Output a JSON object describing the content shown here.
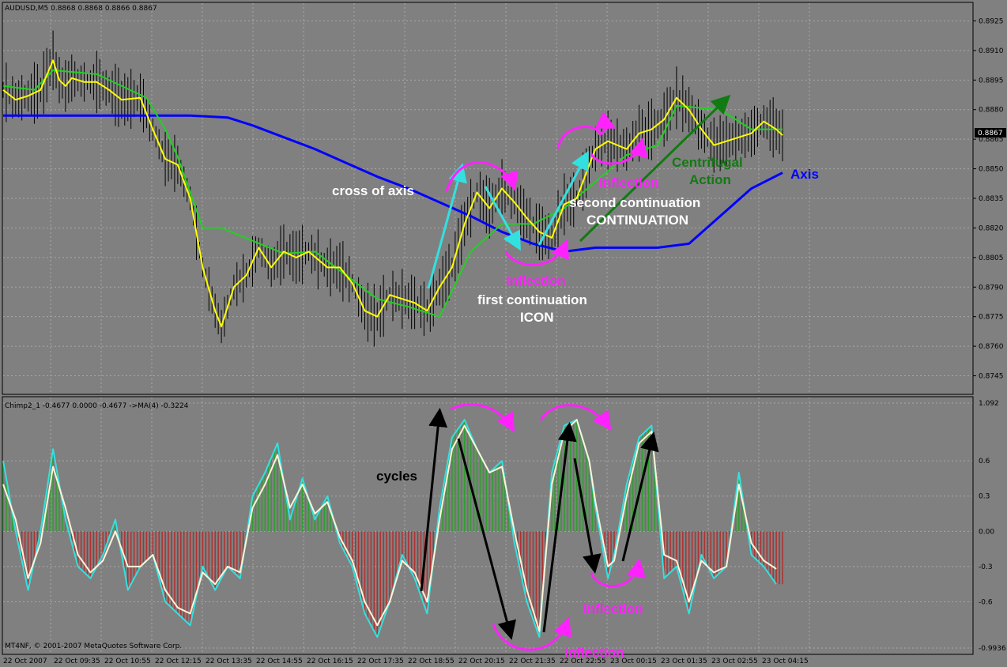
{
  "colors": {
    "background": "#808080",
    "axis_line": "#0000ff",
    "fast_ma": "#ffff00",
    "slow_ma": "#22d022",
    "bars": "#000000",
    "grid": "#a8a8a8",
    "osc_positive": "#2e9e2e",
    "osc_negative": "#b03030",
    "osc_main": "#33e0e0",
    "osc_signal": "#fff4d8",
    "inflection": "#ff22ff",
    "cyan_arrow": "#33e0e0",
    "green_arrow": "#127a12",
    "black_arrow": "#000000"
  },
  "main_panel": {
    "title": "AUDUSD,M5  0.8868 0.8868 0.8866 0.8867",
    "price_tag": "0.8867",
    "annotations": [
      {
        "text": "cross of axis",
        "color": "white"
      },
      {
        "text": "second continuation",
        "color": "white"
      },
      {
        "text": "CONTINUATION",
        "color": "white"
      },
      {
        "text": "inflection",
        "color": "magenta"
      },
      {
        "text": "inflection",
        "color": "magenta"
      },
      {
        "text": "first continuation",
        "color": "white"
      },
      {
        "text": "ICON",
        "color": "white"
      },
      {
        "text": "Centrifugal",
        "color": "green"
      },
      {
        "text": "Action",
        "color": "green"
      },
      {
        "text": "Axis",
        "color": "blue"
      }
    ]
  },
  "sub_panel": {
    "title": "Chimp2_1 -0.4677 0.0000 -0.4677  ->MA(4) -0.3224",
    "copyright": "MT4NF, © 2001-2007 MetaQuotes Software Corp.",
    "annotations": [
      {
        "text": "cycles",
        "color": "black"
      },
      {
        "text": "inflection",
        "color": "magenta"
      },
      {
        "text": "inflection",
        "color": "magenta"
      }
    ]
  },
  "chart_data": [
    {
      "type": "line",
      "title": "AUDUSD,M5  0.8868 0.8868 0.8866 0.8867",
      "y_ticks": [
        "0.8925",
        "0.8910",
        "0.8895",
        "0.8880",
        "0.8865",
        "0.8850",
        "0.8835",
        "0.8820",
        "0.8805",
        "0.8790",
        "0.8775",
        "0.8760",
        "0.8745"
      ],
      "ylim": [
        0.874,
        0.893
      ],
      "x_ticks": [
        "22 Oct 2007",
        "22 Oct 09:35",
        "22 Oct 10:55",
        "22 Oct 12:15",
        "22 Oct 13:35",
        "22 Oct 14:55",
        "22 Oct 16:15",
        "22 Oct 17:35",
        "22 Oct 18:55",
        "22 Oct 20:15",
        "22 Oct 21:35",
        "22 Oct 22:55",
        "23 Oct 00:15",
        "23 Oct 01:35",
        "23 Oct 02:55",
        "23 Oct 04:15"
      ],
      "grid": true,
      "series": [
        {
          "color": "#0000ff",
          "x": [
            0,
            30,
            60,
            72,
            80,
            90,
            100,
            110,
            120,
            130,
            140,
            150,
            160,
            170,
            180,
            190,
            200,
            210,
            220,
            230,
            240,
            250
          ],
          "values": [
            0.8877,
            0.8877,
            0.8877,
            0.8876,
            0.8872,
            0.8866,
            0.886,
            0.8853,
            0.8846,
            0.884,
            0.8833,
            0.8826,
            0.8818,
            0.8812,
            0.8808,
            0.881,
            0.881,
            0.881,
            0.8812,
            0.8826,
            0.884,
            0.8848
          ]
        },
        {
          "color": "#22d022",
          "x": [
            0,
            10,
            16,
            30,
            46,
            52,
            56,
            64,
            70,
            90,
            100,
            120,
            130,
            140,
            150,
            160,
            166,
            170,
            180,
            200,
            210,
            216,
            230,
            240,
            250
          ],
          "values": [
            0.8892,
            0.889,
            0.89,
            0.8898,
            0.8886,
            0.887,
            0.8856,
            0.882,
            0.882,
            0.8807,
            0.8808,
            0.8784,
            0.878,
            0.8775,
            0.8808,
            0.8822,
            0.8822,
            0.8822,
            0.883,
            0.8857,
            0.8862,
            0.8882,
            0.888,
            0.887,
            0.887
          ]
        },
        {
          "color": "#ffff00",
          "x": [
            0,
            4,
            8,
            12,
            16,
            18,
            20,
            22,
            26,
            30,
            34,
            38,
            44,
            48,
            52,
            56,
            60,
            64,
            68,
            70,
            74,
            78,
            82,
            86,
            90,
            94,
            98,
            104,
            108,
            112,
            116,
            120,
            124,
            128,
            132,
            136,
            140,
            144,
            148,
            152,
            156,
            160,
            164,
            168,
            172,
            176,
            180,
            184,
            188,
            190,
            194,
            200,
            204,
            208,
            212,
            216,
            220,
            224,
            228,
            232,
            236,
            240,
            244,
            248,
            250
          ],
          "values": [
            0.889,
            0.8885,
            0.8887,
            0.889,
            0.8905,
            0.8895,
            0.8892,
            0.8896,
            0.8894,
            0.8894,
            0.889,
            0.8885,
            0.8886,
            0.887,
            0.8855,
            0.8852,
            0.8835,
            0.88,
            0.8778,
            0.877,
            0.879,
            0.8796,
            0.881,
            0.88,
            0.8808,
            0.8805,
            0.8808,
            0.88,
            0.88,
            0.8792,
            0.8778,
            0.8775,
            0.8786,
            0.8784,
            0.8782,
            0.8778,
            0.879,
            0.88,
            0.8822,
            0.8838,
            0.883,
            0.884,
            0.8833,
            0.8825,
            0.8818,
            0.8815,
            0.8832,
            0.8835,
            0.8852,
            0.886,
            0.8864,
            0.886,
            0.8868,
            0.887,
            0.8875,
            0.8886,
            0.888,
            0.887,
            0.8862,
            0.8864,
            0.8866,
            0.8868,
            0.8874,
            0.887,
            0.8867
          ]
        }
      ]
    },
    {
      "type": "bar",
      "title": "Chimp2_1 -0.4677 0.0000 -0.4677  ->MA(4) -0.3224",
      "y_ticks": [
        "1.092",
        "0.6",
        "0.3",
        "0.00",
        "-0.3",
        "-0.6",
        "-0.9936"
      ],
      "ylim": [
        -0.9936,
        1.092
      ],
      "grid": true,
      "series": [
        {
          "color": "#33e0e0",
          "x": [
            0,
            4,
            8,
            12,
            16,
            20,
            24,
            28,
            32,
            36,
            40,
            44,
            48,
            52,
            56,
            60,
            64,
            68,
            72,
            76,
            80,
            84,
            88,
            92,
            96,
            100,
            104,
            108,
            112,
            116,
            120,
            124,
            128,
            132,
            136,
            140,
            144,
            148,
            152,
            156,
            160,
            164,
            168,
            172,
            176,
            180,
            184,
            188,
            190,
            194,
            196,
            200,
            204,
            208,
            212,
            216,
            220,
            224,
            228,
            232,
            236,
            240,
            244,
            248
          ],
          "values": [
            0.6,
            0.0,
            -0.5,
            0.0,
            0.7,
            0.1,
            -0.3,
            -0.4,
            -0.2,
            0.1,
            -0.5,
            -0.3,
            -0.2,
            -0.6,
            -0.7,
            -0.8,
            -0.3,
            -0.5,
            -0.3,
            -0.4,
            0.3,
            0.5,
            0.75,
            0.1,
            0.45,
            0.1,
            0.3,
            -0.1,
            -0.3,
            -0.7,
            -0.9,
            -0.6,
            -0.2,
            -0.4,
            -0.7,
            0.2,
            0.8,
            0.95,
            0.7,
            0.5,
            0.6,
            -0.1,
            -0.6,
            -0.9,
            0.5,
            0.9,
            0.95,
            0.6,
            0.2,
            -0.4,
            -0.2,
            0.4,
            0.8,
            0.9,
            -0.4,
            -0.3,
            -0.7,
            -0.2,
            -0.4,
            -0.3,
            0.5,
            -0.2,
            -0.3,
            -0.45
          ]
        },
        {
          "color": "#fff4d8",
          "x": [
            0,
            4,
            8,
            12,
            16,
            20,
            24,
            28,
            32,
            36,
            40,
            44,
            48,
            52,
            56,
            60,
            64,
            68,
            72,
            76,
            80,
            84,
            88,
            92,
            96,
            100,
            104,
            108,
            112,
            116,
            120,
            124,
            128,
            132,
            136,
            140,
            144,
            148,
            152,
            156,
            160,
            164,
            168,
            172,
            176,
            180,
            184,
            188,
            190,
            194,
            196,
            200,
            204,
            208,
            212,
            216,
            220,
            224,
            228,
            232,
            236,
            240,
            244,
            248
          ],
          "values": [
            0.4,
            0.1,
            -0.4,
            -0.1,
            0.55,
            0.2,
            -0.2,
            -0.35,
            -0.25,
            0.0,
            -0.3,
            -0.3,
            -0.2,
            -0.5,
            -0.65,
            -0.7,
            -0.35,
            -0.45,
            -0.3,
            -0.35,
            0.2,
            0.4,
            0.65,
            0.2,
            0.4,
            0.15,
            0.25,
            -0.05,
            -0.25,
            -0.6,
            -0.8,
            -0.6,
            -0.25,
            -0.35,
            -0.6,
            0.1,
            0.7,
            0.9,
            0.7,
            0.5,
            0.55,
            0.0,
            -0.5,
            -0.85,
            0.4,
            0.85,
            0.95,
            0.6,
            0.25,
            -0.3,
            -0.25,
            0.3,
            0.75,
            0.85,
            -0.2,
            -0.25,
            -0.6,
            -0.25,
            -0.35,
            -0.3,
            0.4,
            -0.1,
            -0.25,
            -0.32
          ]
        }
      ]
    }
  ]
}
